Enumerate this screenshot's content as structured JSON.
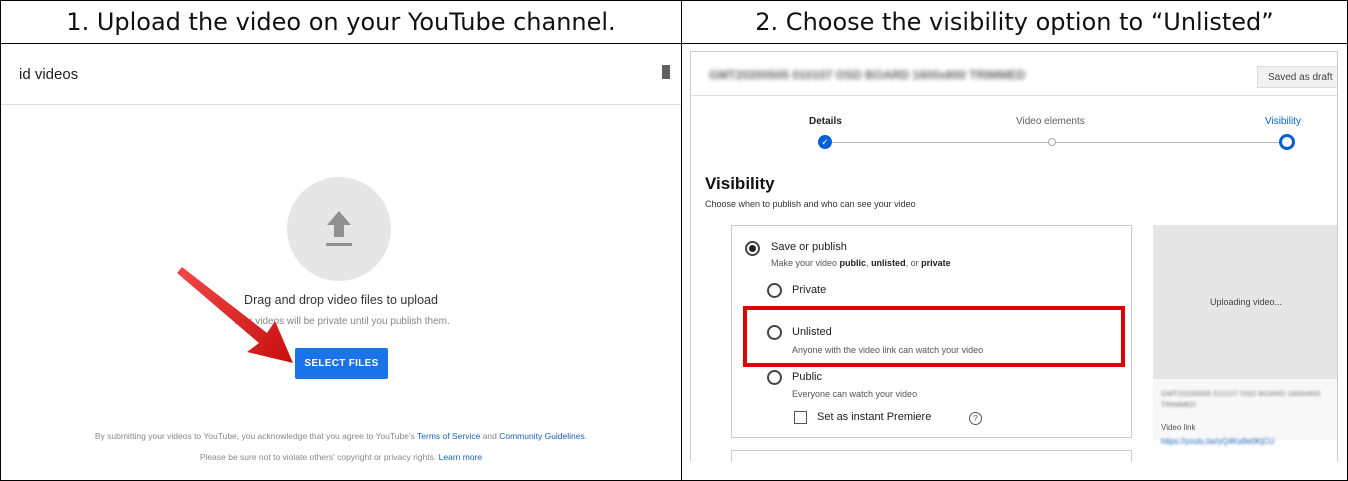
{
  "headers": {
    "step1": "1. Upload the video on your YouTube channel.",
    "step2": "2.  Choose the visibility option to “Unlisted”"
  },
  "upload": {
    "title": "id videos",
    "drag_text": "Drag and drop video files to upload",
    "privacy_text": "Your videos will be private until you publish them.",
    "select_button": "SELECT FILES",
    "terms_prefix": "By submitting your videos to YouTube, you acknowledge that you agree to YouTube's ",
    "terms_link": "Terms of Service",
    "terms_and": " and ",
    "guidelines_link": "Community Guidelines",
    "terms_suffix": ".",
    "note_text": "Please be sure not to violate others' copyright or privacy rights. ",
    "learn_more": "Learn more"
  },
  "details": {
    "video_title": "GMT20200505 010107 OSD BOARD 1600x800 TRIMMED",
    "saved_badge": "Saved as draft",
    "steps": [
      "Details",
      "Video elements",
      "Visibility"
    ],
    "heading": "Visibility",
    "subheading": "Choose when to publish and who can see your video",
    "save_publish": "Save or publish",
    "save_publish_desc_1": "Make your video ",
    "save_publish_desc_public": "public",
    "save_publish_desc_2": ", ",
    "save_publish_desc_unlisted": "unlisted",
    "save_publish_desc_3": ", or ",
    "save_publish_desc_private": "private",
    "private_label": "Private",
    "unlisted_label": "Unlisted",
    "unlisted_desc": "Anyone with the video link can watch your video",
    "public_label": "Public",
    "public_desc": "Everyone can watch your video",
    "premiere_label": "Set as instant Premiere",
    "help_icon": "?",
    "uploading": "Uploading video...",
    "file_name": "GMT20200505 010107 OSD BOARD 1600x800 TRIMMED",
    "video_link_label": "Video link",
    "video_link": "https://youtu.be/yQ4Ka9e0KjCU"
  },
  "colors": {
    "accent_blue": "#065fd4",
    "button_blue": "#1a73e8",
    "highlight_red": "#e00000",
    "arrow_red": "#e01b1b"
  }
}
